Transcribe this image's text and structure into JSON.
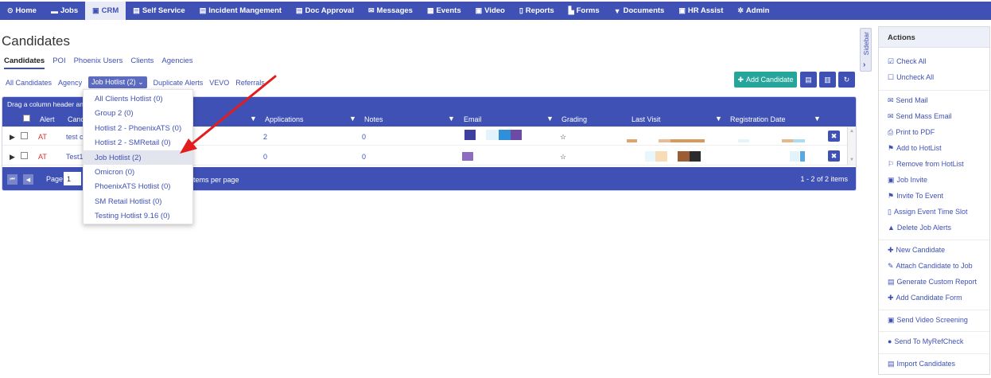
{
  "nav": [
    {
      "icon": "⊙",
      "icon_name": "home-icon",
      "label": "Home"
    },
    {
      "icon": "▬",
      "icon_name": "folder-icon",
      "label": "Jobs"
    },
    {
      "icon": "▣",
      "icon_name": "briefcase-icon",
      "label": "CRM",
      "active": true
    },
    {
      "icon": "▤",
      "icon_name": "id-card-icon",
      "label": "Self Service"
    },
    {
      "icon": "▤",
      "icon_name": "id-card-icon",
      "label": "Incident Mangement"
    },
    {
      "icon": "▤",
      "icon_name": "id-card-icon",
      "label": "Doc Approval"
    },
    {
      "icon": "✉",
      "icon_name": "envelope-icon",
      "label": "Messages"
    },
    {
      "icon": "▦",
      "icon_name": "calendar-icon",
      "label": "Events"
    },
    {
      "icon": "▣",
      "icon_name": "video-icon",
      "label": "Video"
    },
    {
      "icon": "▯",
      "icon_name": "report-icon",
      "label": "Reports"
    },
    {
      "icon": "▙",
      "icon_name": "file-icon",
      "label": "Forms"
    },
    {
      "icon": "▼",
      "icon_name": "filter-icon",
      "label": "Documents"
    },
    {
      "icon": "▣",
      "icon_name": "briefcase-icon",
      "label": "HR Assist"
    },
    {
      "icon": "✲",
      "icon_name": "gear-icon",
      "label": "Admin"
    }
  ],
  "page_title": "Candidates",
  "tabs": [
    "Candidates",
    "POI",
    "Phoenix Users",
    "Clients",
    "Agencies"
  ],
  "filters": [
    "All Candidates",
    "Agency",
    "Job Hotlist (2)",
    "Duplicate Alerts",
    "VEVO",
    "Referrals"
  ],
  "add_candidate_label": "Add Candidate",
  "grid": {
    "group_hint": "Drag a column header and",
    "col_alert": "Alert",
    "col_candidate": "Candi",
    "columns": [
      "Applications",
      "Notes",
      "Email",
      "Grading",
      "Last Visit",
      "Registration Date"
    ],
    "rows": [
      {
        "alert": "AT",
        "name": "test ca",
        "applications": "2",
        "notes": "0",
        "grading": "☆"
      },
      {
        "alert": "AT",
        "name": "Test12",
        "applications": "0",
        "notes": "0",
        "grading": "☆"
      }
    ],
    "page_label": "Page",
    "page_value": "1",
    "items_per_page": "tems per page",
    "items_info": "1 - 2 of 2 items"
  },
  "dropdown": [
    "All Clients Hotlist (0)",
    "Group 2 (0)",
    "Hotlist 2 - PhoenixATS (0)",
    "Hotlist 2 - SMRetail (0)",
    "Job Hotlist (2)",
    "Omicron (0)",
    "PhoenixATS Hotlist (0)",
    "SM Retail Hotlist (0)",
    "Testing Hotlist 9.16 (0)"
  ],
  "sidebar_label": "Sidebar",
  "actions_title": "Actions",
  "actions": [
    {
      "icon": "☑",
      "icon_name": "check-square-icon",
      "label": "Check All"
    },
    {
      "icon": "☐",
      "icon_name": "square-icon",
      "label": "Uncheck All"
    },
    {
      "icon": "✉",
      "icon_name": "envelope-icon",
      "label": "Send Mail"
    },
    {
      "icon": "✉",
      "icon_name": "envelope-icon",
      "label": "Send Mass Email"
    },
    {
      "icon": "⎙",
      "icon_name": "print-icon",
      "label": "Print to PDF"
    },
    {
      "icon": "⚑",
      "icon_name": "flag-icon",
      "label": "Add to HotList"
    },
    {
      "icon": "⚐",
      "icon_name": "flag-outline-icon",
      "label": "Remove from HotList"
    },
    {
      "icon": "▣",
      "icon_name": "briefcase-icon",
      "label": "Job Invite"
    },
    {
      "icon": "⚑",
      "icon_name": "flag-icon",
      "label": "Invite To Event"
    },
    {
      "icon": "▯",
      "icon_name": "mobile-icon",
      "label": "Assign Event Time Slot"
    },
    {
      "icon": "▲",
      "icon_name": "warning-icon",
      "label": "Delete Job Alerts"
    },
    {
      "icon": "✚",
      "icon_name": "plus-icon",
      "label": "New Candidate"
    },
    {
      "icon": "✎",
      "icon_name": "paperclip-icon",
      "label": "Attach Candidate to Job"
    },
    {
      "icon": "▤",
      "icon_name": "table-icon",
      "label": "Generate Custom Report"
    },
    {
      "icon": "✚",
      "icon_name": "plus-icon",
      "label": "Add Candidate Form"
    },
    {
      "icon": "▣",
      "icon_name": "video-icon",
      "label": "Send Video Screening"
    },
    {
      "icon": "●",
      "icon_name": "apple-icon",
      "label": "Send To MyRefCheck"
    },
    {
      "icon": "▤",
      "icon_name": "table-icon",
      "label": "Import Candidates"
    }
  ]
}
